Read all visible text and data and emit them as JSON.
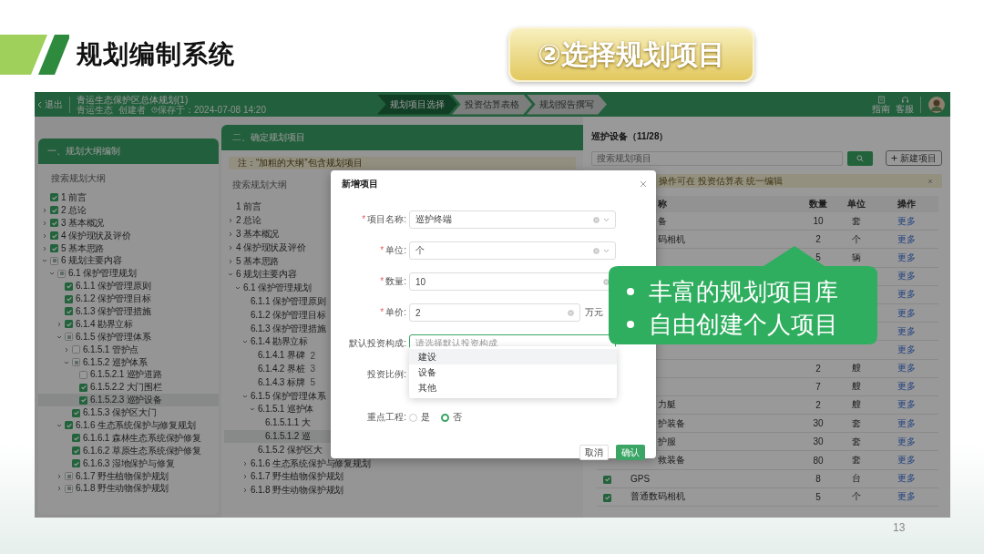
{
  "slide": {
    "title": "规划编制系统",
    "step": "②选择规划项目",
    "page_number": "13"
  },
  "app": {
    "header": {
      "back": "退出",
      "project_title": "青运生态保护区总体规划(1)",
      "meta": [
        "青运生态",
        "创建者",
        "保存于：2024-07-08 14:20"
      ],
      "steps": [
        {
          "label": "规划项目选择",
          "selected": true
        },
        {
          "label": "投资估算表格",
          "selected": false
        },
        {
          "label": "规划报告撰写",
          "selected": false
        }
      ],
      "tools": [
        "指南",
        "客服"
      ]
    },
    "outline_panel": {
      "title": "一、规划大纲编制",
      "search_placeholder": "搜索规划大纲",
      "items": [
        {
          "label": "1 前言",
          "checked": true,
          "indeterminate": false,
          "selected": false
        },
        {
          "label": "2 总论",
          "checked": true,
          "indeterminate": false,
          "expanded": false,
          "selected": false
        },
        {
          "label": "3 基本概况",
          "checked": true,
          "indeterminate": false,
          "expanded": false,
          "selected": false
        },
        {
          "label": "4 保护现状及评价",
          "checked": true,
          "indeterminate": false,
          "expanded": false,
          "selected": false
        },
        {
          "label": "5 基本思路",
          "checked": true,
          "indeterminate": false,
          "expanded": false,
          "selected": false
        },
        {
          "label": "6 规划主要内容",
          "checked": false,
          "indeterminate": true,
          "expanded": true,
          "selected": false,
          "children": [
            {
              "label": "6.1 保护管理规划",
              "checked": false,
              "indeterminate": true,
              "expanded": true,
              "selected": false,
              "children": [
                {
                  "label": "6.1.1 保护管理原则",
                  "checked": true,
                  "indeterminate": false,
                  "selected": false
                },
                {
                  "label": "6.1.2 保护管理目标",
                  "checked": true,
                  "indeterminate": false,
                  "selected": false
                },
                {
                  "label": "6.1.3 保护管理措施",
                  "checked": true,
                  "indeterminate": false,
                  "selected": false
                },
                {
                  "label": "6.1.4 勘界立标",
                  "checked": true,
                  "indeterminate": false,
                  "expanded": false,
                  "selected": false
                },
                {
                  "label": "6.1.5 保护管理体系",
                  "checked": false,
                  "indeterminate": true,
                  "expanded": true,
                  "selected": false,
                  "children": [
                    {
                      "label": "6.1.5.1 管护点",
                      "checked": false,
                      "indeterminate": false,
                      "expanded": false,
                      "selected": false
                    },
                    {
                      "label": "6.1.5.2 巡护体系",
                      "checked": false,
                      "indeterminate": true,
                      "expanded": true,
                      "selected": false,
                      "children": [
                        {
                          "label": "6.1.5.2.1 巡护道路",
                          "checked": false,
                          "indeterminate": false,
                          "selected": false
                        },
                        {
                          "label": "6.1.5.2.2 大门围栏",
                          "checked": true,
                          "indeterminate": false,
                          "selected": false
                        },
                        {
                          "label": "6.1.5.2.3 巡护设备",
                          "checked": true,
                          "indeterminate": false,
                          "selected": true
                        }
                      ]
                    },
                    {
                      "label": "6.1.5.3 保护区大门",
                      "checked": true,
                      "indeterminate": false,
                      "selected": false
                    }
                  ]
                },
                {
                  "label": "6.1.6 生态系统保护与修复规划",
                  "checked": true,
                  "indeterminate": false,
                  "expanded": true,
                  "selected": false,
                  "children": [
                    {
                      "label": "6.1.6.1 森林生态系统保护修复",
                      "checked": true,
                      "indeterminate": false,
                      "selected": false
                    },
                    {
                      "label": "6.1.6.2 草原生态系统保护修复",
                      "checked": true,
                      "indeterminate": false,
                      "selected": false
                    },
                    {
                      "label": "6.1.6.3 湿地保护与修复",
                      "checked": true,
                      "indeterminate": false,
                      "selected": false
                    }
                  ]
                },
                {
                  "label": "6.1.7 野生植物保护规划",
                  "checked": false,
                  "indeterminate": true,
                  "expanded": false,
                  "selected": false
                },
                {
                  "label": "6.1.8 野生动物保护规划",
                  "checked": false,
                  "indeterminate": true,
                  "expanded": false,
                  "selected": false
                }
              ]
            }
          ]
        }
      ]
    },
    "project_panel": {
      "title": "二、确定规划项目",
      "notice": "注：“加粗的大纲”包含规划项目",
      "search_placeholder": "搜索规划大纲",
      "items": [
        {
          "label": "1 前言",
          "selected": false
        },
        {
          "label": "2 总论",
          "expanded": false,
          "selected": false
        },
        {
          "label": "3 基本概况",
          "expanded": false,
          "selected": false
        },
        {
          "label": "4 保护现状及评价",
          "expanded": false,
          "selected": false
        },
        {
          "label": "5 基本思路",
          "expanded": false,
          "selected": false
        },
        {
          "label": "6 规划主要内容",
          "expanded": true,
          "selected": false,
          "children": [
            {
              "label": "6.1 保护管理规划",
              "expanded": true,
              "selected": false,
              "children": [
                {
                  "label": "6.1.1 保护管理原则",
                  "selected": false
                },
                {
                  "label": "6.1.2 保护管理目标",
                  "selected": false
                },
                {
                  "label": "6.1.3 保护管理措施",
                  "selected": false
                },
                {
                  "label": "6.1.4 勘界立标",
                  "expanded": true,
                  "selected": false,
                  "children": [
                    {
                      "label": "6.1.4.1 界碑",
                      "count": "2",
                      "selected": false
                    },
                    {
                      "label": "6.1.4.2 界桩",
                      "count": "3",
                      "selected": false
                    },
                    {
                      "label": "6.1.4.3 标牌",
                      "count": "5",
                      "selected": false
                    }
                  ]
                },
                {
                  "label": "6.1.5 保护管理体系",
                  "expanded": true,
                  "selected": false,
                  "children": [
                    {
                      "label": "6.1.5.1 巡护体",
                      "expanded": true,
                      "selected": false,
                      "children": [
                        {
                          "label": "6.1.5.1.1 大",
                          "selected": false
                        },
                        {
                          "label": "6.1.5.1.2 巡",
                          "selected": true
                        }
                      ]
                    },
                    {
                      "label": "6.1.5.2 保护区大",
                      "selected": false
                    }
                  ]
                },
                {
                  "label": "6.1.6 生态系统保护与修复规划",
                  "expanded": false,
                  "selected": false
                },
                {
                  "label": "6.1.7 野生植物保护规划",
                  "expanded": false,
                  "selected": false
                },
                {
                  "label": "6.1.8 野生动物保护规划",
                  "expanded": false,
                  "selected": false
                }
              ]
            }
          ]
        }
      ]
    },
    "equipment_panel": {
      "title": "巡护设备（11/28）",
      "search_placeholder": "搜索规划项目",
      "new_button": "新建项目",
      "notice": "操作可在 投资估算表 统一编辑",
      "columns": [
        "称",
        "数量",
        "单位",
        "操作"
      ],
      "rows": [
        {
          "name": "备",
          "quantity": "10",
          "unit": "套",
          "action": "更多"
        },
        {
          "name": "码相机",
          "quantity": "2",
          "unit": "个",
          "action": "更多"
        },
        {
          "quantity": "5",
          "unit": "辆",
          "action": "更多"
        },
        {
          "action": "更多"
        },
        {
          "action": "更多"
        },
        {
          "action": "更多"
        },
        {
          "action": "更多"
        },
        {
          "action": "更多"
        },
        {
          "quantity": "2",
          "unit": "艘",
          "action": "更多"
        },
        {
          "quantity": "7",
          "unit": "艘",
          "action": "更多"
        },
        {
          "name": "力艇",
          "quantity": "2",
          "unit": "艘",
          "action": "更多"
        },
        {
          "name": "护装备",
          "quantity": "30",
          "unit": "套",
          "action": "更多"
        },
        {
          "name": "护服",
          "quantity": "30",
          "unit": "套",
          "action": "更多"
        },
        {
          "name": "救装备",
          "quantity": "80",
          "unit": "套",
          "action": "更多"
        },
        {
          "checked": true,
          "name": "GPS",
          "quantity": "8",
          "unit": "台",
          "action": "更多"
        },
        {
          "checked": true,
          "name": "普通数码相机",
          "quantity": "5",
          "unit": "个",
          "action": "更多"
        }
      ]
    },
    "dialog": {
      "title": "新增项目",
      "fields": [
        {
          "kind": "select",
          "mark": "*",
          "label": "项目名称:",
          "value": "巡护终端"
        },
        {
          "kind": "select",
          "mark": "*",
          "label": "单位:",
          "value": "个"
        },
        {
          "kind": "number",
          "mark": "*",
          "label": "数量:",
          "value": "10"
        },
        {
          "kind": "number",
          "mark": "*",
          "label": "单价:",
          "value": "2",
          "suffix": "万元"
        },
        {
          "kind": "dropdown",
          "label": "默认投资构成:",
          "placeholder": "请选择默认投资构成",
          "focused": true,
          "options": [
            {
              "label": "建设",
              "highlighted": true
            },
            {
              "label": "设备",
              "highlighted": false
            },
            {
              "label": "其他",
              "highlighted": false
            }
          ]
        },
        {
          "kind": "blank",
          "label": "投资比例:"
        },
        {
          "kind": "radio",
          "label": "重点工程:",
          "options": [
            {
              "label": "是",
              "selected": false
            },
            {
              "label": "否",
              "selected": true
            }
          ]
        }
      ],
      "buttons": [
        {
          "label": "取消",
          "primary": false
        },
        {
          "label": "确认",
          "primary": true
        }
      ]
    }
  },
  "callout": {
    "items": [
      "丰富的规划项目库",
      "自由创建个人项目"
    ]
  }
}
